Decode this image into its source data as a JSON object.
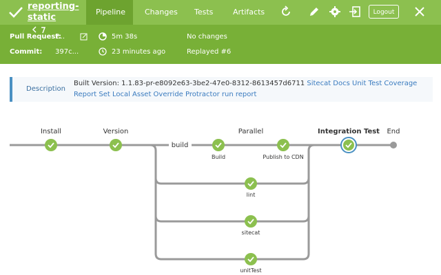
{
  "header": {
    "repo_line1": "reporting-",
    "repo_line2": "static",
    "tabs": [
      "Pipeline",
      "Changes",
      "Tests",
      "Artifacts"
    ],
    "logout_label": "Logout",
    "accent": "#8cc04f"
  },
  "meta": {
    "pull_request_label": "Pull Request:",
    "pull_request_value": "P...",
    "commit_label": "Commit:",
    "commit_value": "397c...",
    "duration": "5m 38s",
    "time_ago": "23 minutes ago",
    "changes": "No changes",
    "replayed": "Replayed #6"
  },
  "description": {
    "label": "Description",
    "built_prefix": "Built Version: 1.1.83-pr-e8092e63-3be2-47e0-8312-8613457d6711",
    "links": [
      "Sitecat Docs",
      "Unit Test Coverage Report",
      "Set Local Asset Override",
      "Protractor run report"
    ]
  },
  "pipeline": {
    "stages": [
      "Install",
      "Version",
      "Parallel",
      "Integration Test",
      "End"
    ],
    "build_label": "build",
    "nodes": [
      "Build",
      "Publish to CDN",
      "lint",
      "sitecat",
      "unitTest"
    ]
  }
}
